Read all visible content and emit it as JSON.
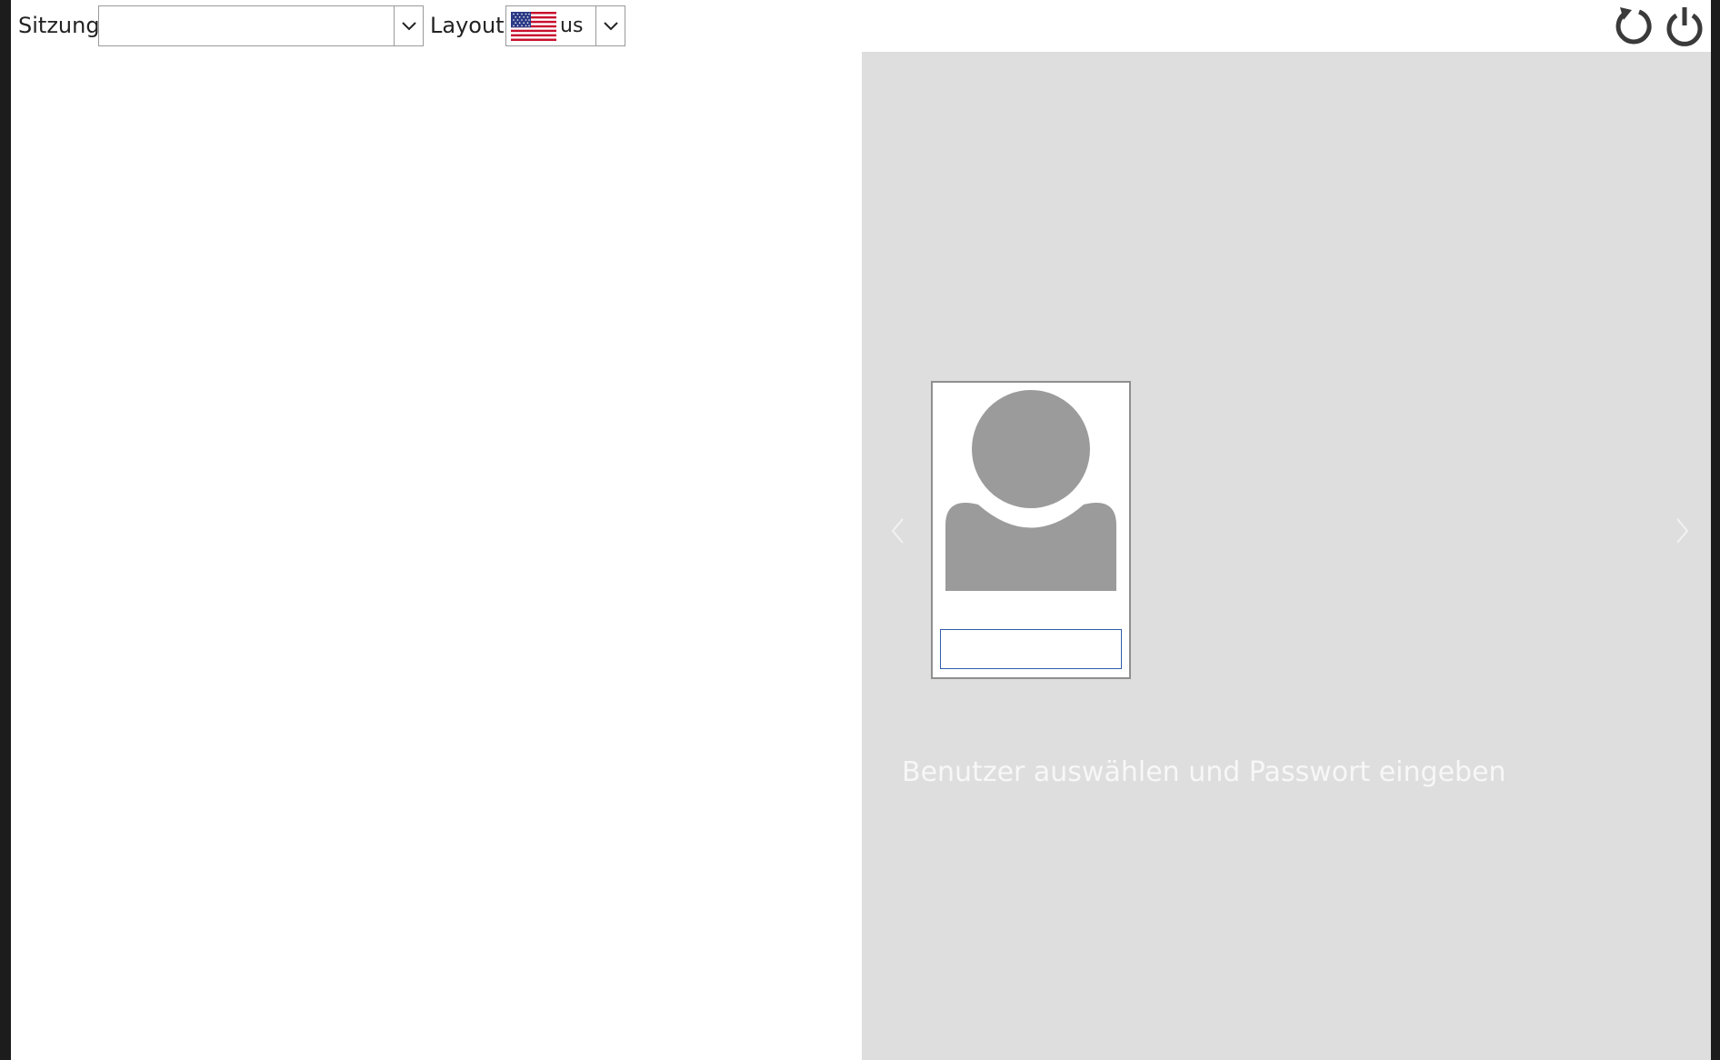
{
  "topbar": {
    "session_label": "Sitzung",
    "session_value": "",
    "layout_label": "Layout",
    "layout_value": "us",
    "layout_flag": "us-flag-icon"
  },
  "actions": {
    "restart_icon": "restart-icon",
    "shutdown_icon": "power-icon"
  },
  "greeter": {
    "user_name": "",
    "password_value": "",
    "prompt": "Benutzer auswählen und Passwort eingeben"
  },
  "colors": {
    "panel_background": "#dedede",
    "avatar": "#9b9b9b",
    "password_border": "#2f5ea8",
    "prompt_text": "#f7f7f7"
  }
}
